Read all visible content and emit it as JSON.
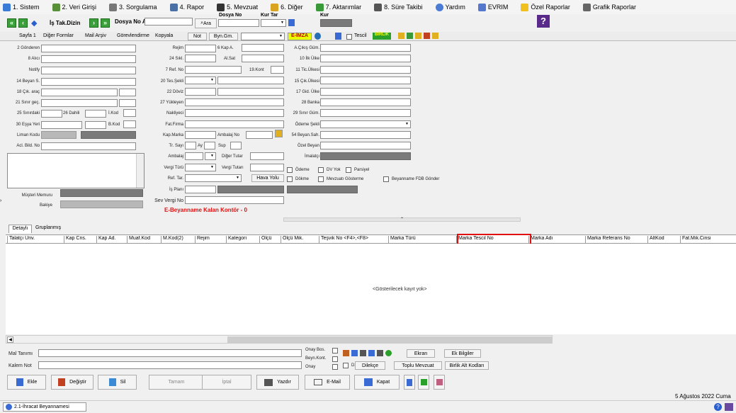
{
  "menu": [
    "1. Sistem",
    "2. Veri Girişi",
    "3. Sorgulama",
    "4. Rapor",
    "5. Mevzuat",
    "6. Diğer",
    "7. Aktarımlar",
    "8. Süre Takibi",
    "Yardım",
    "EVRIM",
    "Özel Raporlar",
    "Grafik Raporlar"
  ],
  "toolbar": {
    "is_takip": "İş Tak.Dizin",
    "dosya_ara": "Dosya No Ara",
    "ara": "Ara",
    "dosya_no": "Dosya No",
    "kur_tar": "Kur Tar",
    "kur": "Kur"
  },
  "tabs": [
    "Sayfa 1",
    "Diğer Formlar",
    "Mail Arşiv",
    "Görevlendirme",
    "Kopyala",
    "Not",
    "Byn.Gm.",
    "E-İMZA",
    "Tescil",
    "BİRLİK"
  ],
  "labels": {
    "gonderen": "2 Gönderen",
    "alici": "8 Alıcı",
    "notify": "Notify",
    "beyan_s": "14 Beyan S.",
    "cik_arac": "18 Çık. araç",
    "sinir_gec": "21 Sınır geç.",
    "sinirdaki": "25 Sınırdaki",
    "dahili": "26 Dahili",
    "ikod": "İ.Kod",
    "esya_yeri": "30 Eşya Yeri",
    "bkod": "B.Kod",
    "liman": "Liman Kodu",
    "acil": "Acl. Bild. No",
    "musteri": "Müşteri Memuru",
    "bakiye": "Bakiye",
    "rejim": "Rejim",
    "kap_a": "6 Kap A.",
    "sikl": "24 Sıkl.",
    "a_sat": "Al.Sat",
    "ref": "7 Ref. No",
    "tkont": "19.Kont",
    "tes_sekli": "20 Tes.Şekli",
    "doviz": "22 Döviz",
    "yuk": "27 Yükleyen",
    "nakliye": "Nakliyeci",
    "fat": "Fat.Firma",
    "kap_marka": "Kap.Marka",
    "ambalaj": "Ambalaj No",
    "tr_say": "Tr. Sayı",
    "ay": "Ay",
    "sup": "Sup",
    "amb": "Ambalaj",
    "diger": "Diğer Tutar",
    "vergi": "Vergi Türü",
    "vergi_t": "Vergi Tutarı",
    "ref_tar": "Ref. Tar.",
    "hava": "Hava Yolu",
    "is_plani": "İş Planı",
    "sev": "Sev Vergi No",
    "cikis": "A.Çıkış Güm.",
    "ilk": "10 İlk Ülke",
    "tic": "11 Tic.Ülkesi",
    "cik_ulke": "15 Çık.Ülkesi",
    "gid": "17 Gid. Ülke",
    "banka": "28 Banka",
    "sinir_gum": "29 Sınır Güm.",
    "odeme": "Ödeme Şekli",
    "beyan_sah": "54 Beyan.Sah.",
    "ozel": "Özel Beyan",
    "imalatci": "İmalatçı",
    "ch_odeme": "Ödeme",
    "ch_dv": "DV Yok",
    "ch_parsiyel": "Parsiyel",
    "ch_dokme": "Dökme",
    "ch_mevzuat": "Mevzuatı Gösterme",
    "ch_fdb": "Beyanname FDB Gönder"
  },
  "ekontor": "E-Beyanname Kalan Kontör - 0",
  "subtabs": [
    "Detaylı",
    "Gruplanmış"
  ],
  "columns": [
    "Talatçı Unv.",
    "Kap Cns.",
    "Kap Ad.",
    "Muaf.Kod",
    "M.Kod(2)",
    "Rejim",
    "Kategori",
    "Ölçü",
    "Ölçü Mik.",
    "Teşvik No <F4>,<F8>",
    "Marka Türü",
    "Marka Tescil No",
    "Marka Adı",
    "Marka Referans No",
    "AltKod",
    "Fat.Mik.Cinsi"
  ],
  "empty": "<Gösterilecek kayıt yok>",
  "bottom": {
    "mal": "Mal Tanımı",
    "kalem": "Kalem Not",
    "onay_bos": "Onay Bos.",
    "beyn_kont": "Beyn.Kont.",
    "onay": "Onay",
    "ekran": "Ekran",
    "ek_bilgi": "Ek Bilgiler",
    "dzk": "Dzk",
    "dilekce": "Dilekçe",
    "toplu": "Toplu Mevzuat",
    "birlik": "Birlik Alt Kodları"
  },
  "actions": [
    "Ekle",
    "Değiştir",
    "Sil",
    "Tamam",
    "İptal",
    "Yazdır",
    "E-Mail",
    "Kapat"
  ],
  "date": "5 Ağustos 2022 Cuma",
  "taskbar": "2.1-İhracat Beyannamesi"
}
